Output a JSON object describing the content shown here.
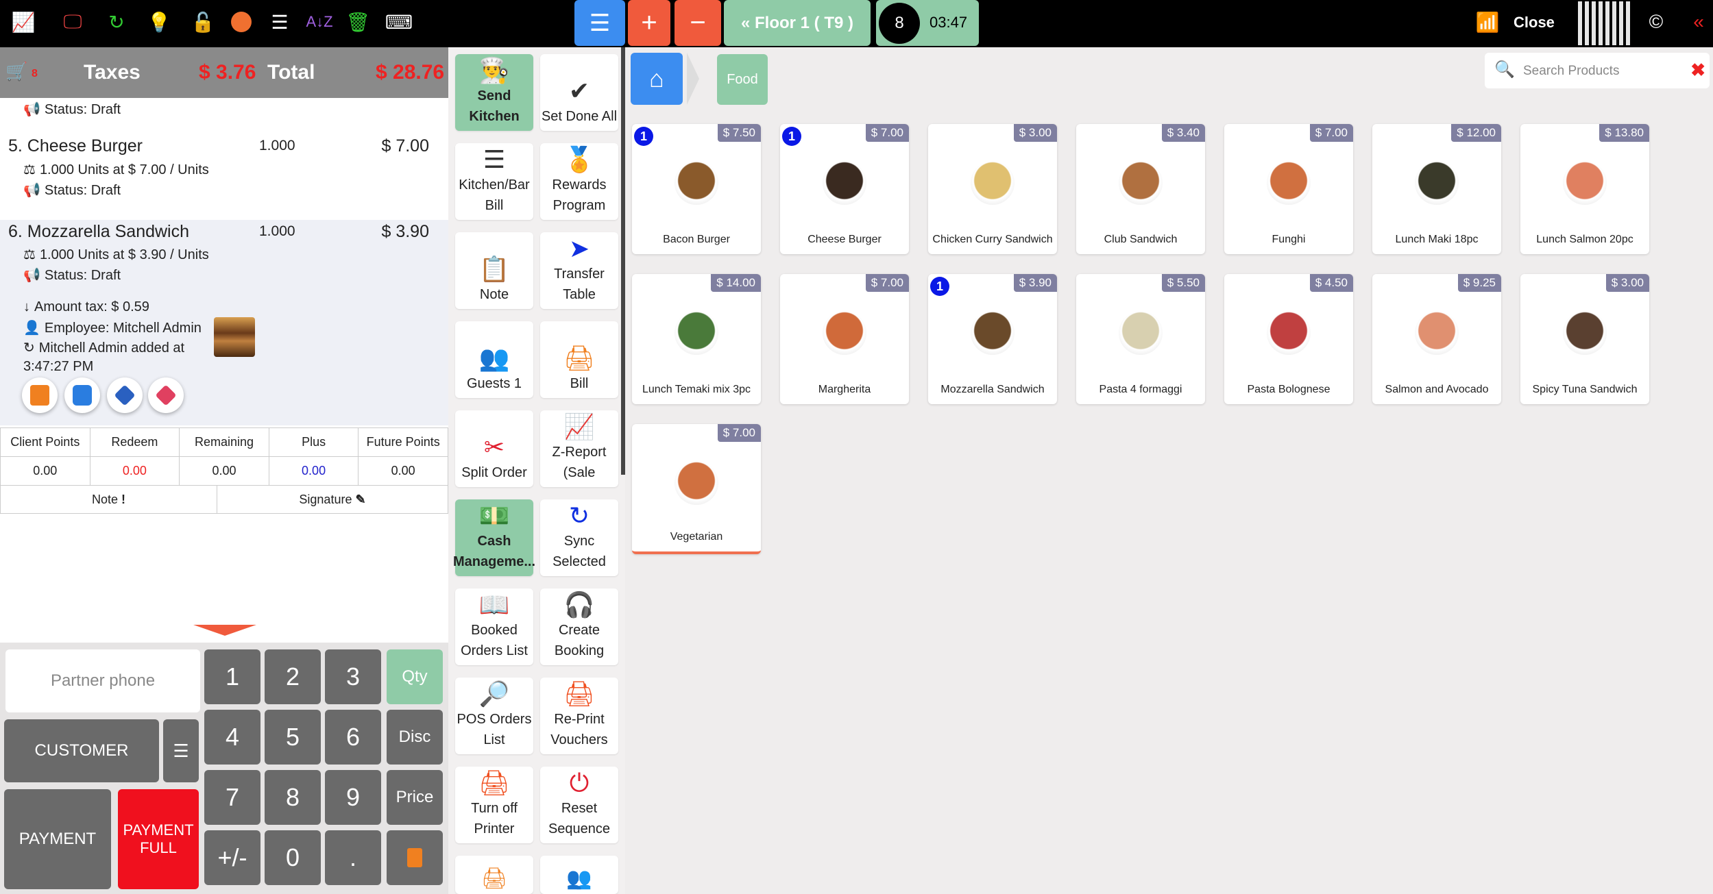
{
  "topbar": {
    "floor": "Floor 1 ( T9 )",
    "guests": "8",
    "time": "03:47",
    "close": "Close"
  },
  "order": {
    "taxes_label": "Taxes",
    "taxes": "$ 3.76",
    "total_label": "Total",
    "total": "$ 28.76",
    "cart_count": "8",
    "top_status": "Status: Draft",
    "lines": [
      {
        "name": "5. Cheese Burger",
        "qty": "1.000",
        "price": "$ 7.00",
        "units": "1.000 Units at $ 7.00 / Units",
        "status": "Status: Draft"
      },
      {
        "name": "6. Mozzarella Sandwich",
        "qty": "1.000",
        "price": "$ 3.90",
        "units": "1.000 Units at $ 3.90 / Units",
        "status": "Status: Draft",
        "tax": "Amount tax: $ 0.59",
        "employee": "Employee: Mitchell Admin",
        "added": "Mitchell Admin added at",
        "added_time": "3:47:27 PM"
      }
    ]
  },
  "points": {
    "headers": [
      "Client Points",
      "Redeem",
      "Remaining",
      "Plus",
      "Future Points"
    ],
    "values": [
      "0.00",
      "0.00",
      "0.00",
      "0.00",
      "0.00"
    ]
  },
  "note_label": "Note",
  "signature_label": "Signature",
  "pad": {
    "partner_placeholder": "Partner phone",
    "customer": "CUSTOMER",
    "payment": "PAYMENT",
    "payment_full": "PAYMENT FULL",
    "qty": "Qty",
    "disc": "Disc",
    "price": "Price",
    "keys": [
      "1",
      "2",
      "3",
      "4",
      "5",
      "6",
      "7",
      "8",
      "9",
      "+/-",
      "0",
      "."
    ]
  },
  "controls": [
    {
      "label": "Send Kitchen",
      "icon": "chef-icon",
      "green": true
    },
    {
      "label": "Set Done All",
      "icon": "check-icon"
    },
    {
      "label": "Kitchen/Bar Bill",
      "icon": "list-icon"
    },
    {
      "label": "Rewards Program",
      "icon": "medal-icon"
    },
    {
      "label": "Note",
      "icon": "note-icon"
    },
    {
      "label": "Transfer Table",
      "icon": "cursor-icon"
    },
    {
      "label": "Guests 1",
      "icon": "guests-icon"
    },
    {
      "label": "Bill",
      "icon": "printer-icon"
    },
    {
      "label": "Split Order",
      "icon": "scissors-icon"
    },
    {
      "label": "Z-Report (Sale",
      "icon": "chart-icon"
    },
    {
      "label": "Cash Manageme...",
      "icon": "register-icon",
      "green": true
    },
    {
      "label": "Sync Selected",
      "icon": "sync-icon"
    },
    {
      "label": "Booked Orders List",
      "icon": "booked-icon"
    },
    {
      "label": "Create Booking",
      "icon": "booking-icon"
    },
    {
      "label": "POS Orders List",
      "icon": "orders-icon"
    },
    {
      "label": "Re-Print Vouchers",
      "icon": "reprint-icon"
    },
    {
      "label": "Turn off Printer",
      "icon": "printer-off-icon"
    },
    {
      "label": "Reset Sequence",
      "icon": "reset-icon"
    }
  ],
  "breadcrumb": {
    "category": "Food"
  },
  "search": {
    "placeholder": "Search Products"
  },
  "products": [
    {
      "name": "Bacon Burger",
      "price": "$ 7.50",
      "count": "1",
      "color": "#8a5a2b"
    },
    {
      "name": "Cheese Burger",
      "price": "$ 7.00",
      "count": "1",
      "color": "#3a2a20"
    },
    {
      "name": "Chicken Curry Sandwich",
      "price": "$ 3.00",
      "color": "#e0c070"
    },
    {
      "name": "Club Sandwich",
      "price": "$ 3.40",
      "color": "#b07040"
    },
    {
      "name": "Funghi",
      "price": "$ 7.00",
      "color": "#d07040"
    },
    {
      "name": "Lunch Maki 18pc",
      "price": "$ 12.00",
      "color": "#3a3a2a"
    },
    {
      "name": "Lunch Salmon 20pc",
      "price": "$ 13.80",
      "color": "#e08060"
    },
    {
      "name": "Lunch Temaki mix 3pc",
      "price": "$ 14.00",
      "color": "#4a7a3a"
    },
    {
      "name": "Margherita",
      "price": "$ 7.00",
      "color": "#d06a3a"
    },
    {
      "name": "Mozzarella Sandwich",
      "price": "$ 3.90",
      "count": "1",
      "color": "#6a4a2a"
    },
    {
      "name": "Pasta 4 formaggi",
      "price": "$ 5.50",
      "color": "#d8d0b0"
    },
    {
      "name": "Pasta Bolognese",
      "price": "$ 4.50",
      "color": "#c04040"
    },
    {
      "name": "Salmon and Avocado",
      "price": "$ 9.25",
      "color": "#e09070"
    },
    {
      "name": "Spicy Tuna Sandwich",
      "price": "$ 3.00",
      "color": "#5a4030"
    },
    {
      "name": "Vegetarian",
      "price": "$ 7.00",
      "color": "#d07040"
    }
  ]
}
